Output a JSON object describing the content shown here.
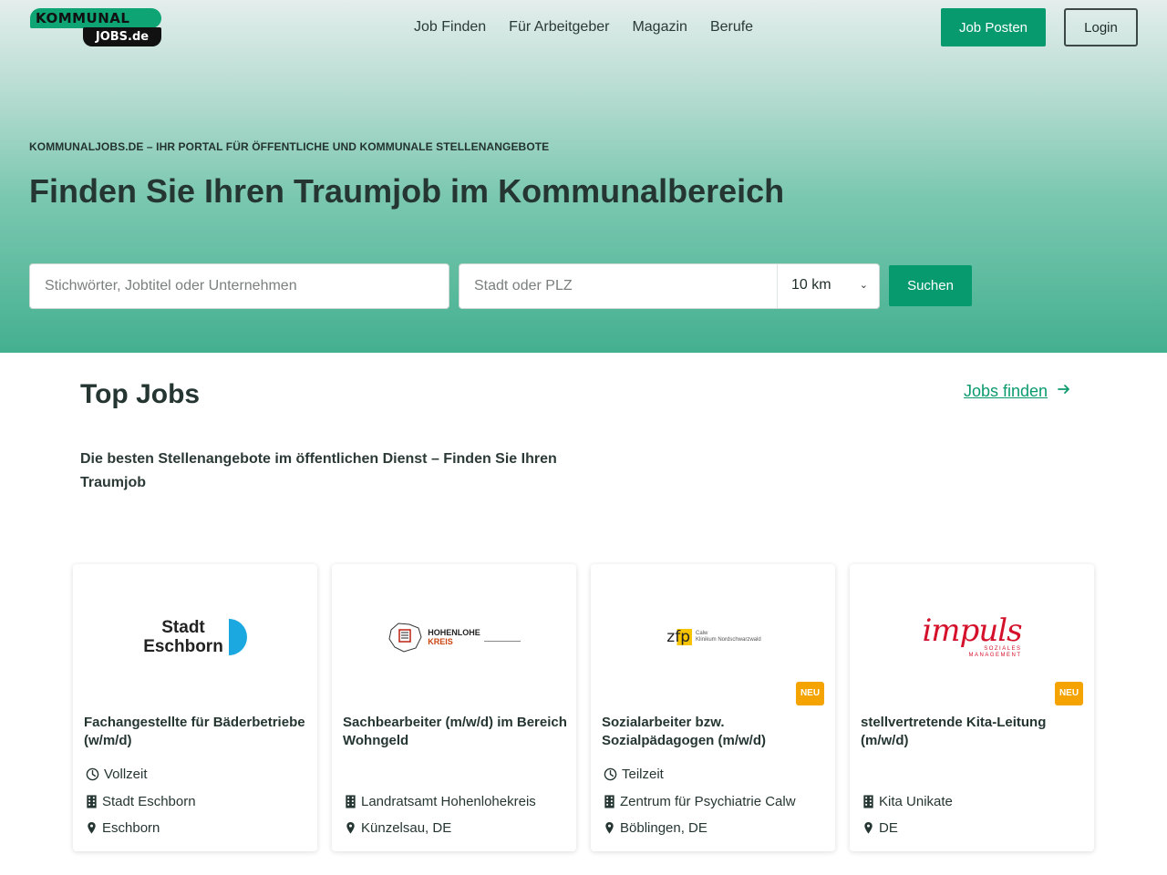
{
  "header": {
    "logo_top": "KOMMUNAL",
    "logo_bottom": "JOBS.de",
    "nav": [
      "Job Finden",
      "Für Arbeitgeber",
      "Magazin",
      "Berufe"
    ],
    "post_job_label": "Job Posten",
    "login_label": "Login"
  },
  "hero": {
    "eyebrow": "KOMMUNALJOBS.DE – IHR PORTAL FÜR ÖFFENTLICHE UND KOMMUNALE STELLENANGEBOTE",
    "headline": "Finden Sie Ihren Traumjob im Kommunalbereich"
  },
  "search": {
    "keyword_placeholder": "Stichwörter, Jobtitel oder Unternehmen",
    "location_placeholder": "Stadt oder PLZ",
    "radius_value": "10 km",
    "submit_label": "Suchen"
  },
  "top_jobs": {
    "title": "Top Jobs",
    "link_label": "Jobs finden",
    "subtitle": "Die besten Stellenangebote im öffentlichen Dienst – Finden Sie Ihren Traumjob"
  },
  "jobs": [
    {
      "logo_text": [
        "Stadt",
        "Eschborn"
      ],
      "title": "Fachangestellte für Bäderbetriebe (w/m/d)",
      "employment": "Vollzeit",
      "company": "Stadt Eschborn",
      "location": "Eschborn",
      "new": false
    },
    {
      "logo_text": [
        "HOHENLOHE",
        "KREIS"
      ],
      "title": "Sachbearbeiter (m/w/d) im Bereich Wohngeld",
      "employment": "",
      "company": "Landratsamt Hohenlohekreis",
      "location": "Künzelsau, DE",
      "new": false
    },
    {
      "logo_text": [
        "zfp",
        "Calw",
        "Klinikum Nordschwarzwald"
      ],
      "title": "Sozialarbeiter bzw. Sozialpädagogen (m/w/d)",
      "employment": "Teilzeit",
      "company": "Zentrum für Psychiatrie Calw",
      "location": "Böblingen, DE",
      "new": true
    },
    {
      "logo_text": [
        "impuls",
        "SOZIALES",
        "MANAGEMENT"
      ],
      "title": "stellvertretende Kita-Leitung (m/w/d)",
      "employment": "",
      "company": "Kita Unikate",
      "location": "DE",
      "new": true
    }
  ],
  "badge_label": "NEU",
  "colors": {
    "brand_green": "#079a6e",
    "badge_orange": "#f4a300",
    "eschborn_blue": "#1ba8e0",
    "impuls_red": "#d4102a"
  }
}
